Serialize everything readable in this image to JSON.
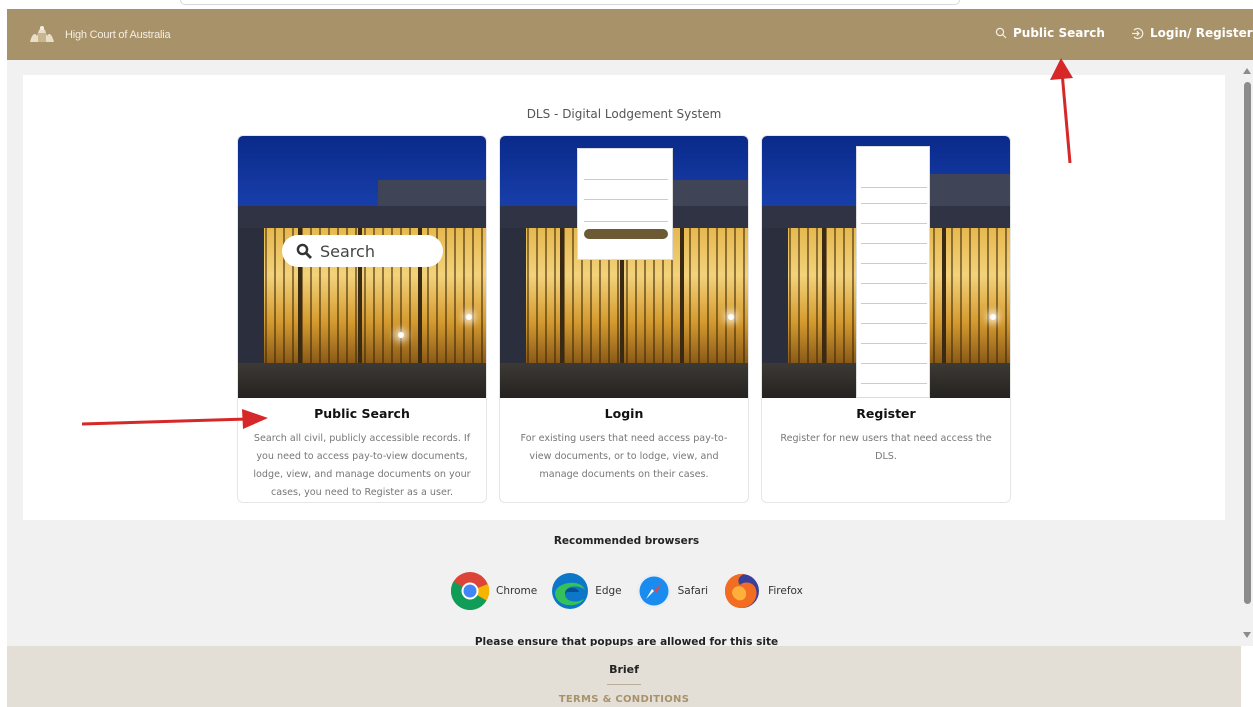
{
  "header": {
    "brand": "High Court of Australia",
    "nav": [
      {
        "label": "Public Search",
        "icon": "search-icon"
      },
      {
        "label": "Login/ Register",
        "icon": "login-icon"
      }
    ],
    "bg_color": "#a8926a"
  },
  "page_title": "DLS - Digital Lodgement System",
  "cards": [
    {
      "title": "Public Search",
      "description": "Search all civil, publicly accessible records. If you need to access pay-to-view documents, lodge, view, and manage documents on your cases, you need to Register as a user.",
      "overlay": {
        "search_label": "Search"
      }
    },
    {
      "title": "Login",
      "description": "For existing users that need access pay-to-view documents, or to lodge, view, and manage documents on their cases."
    },
    {
      "title": "Register",
      "description": "Register for new users that need access the DLS."
    }
  ],
  "browsers_section": {
    "title": "Recommended browsers",
    "browsers": [
      {
        "label": "Chrome",
        "icon": "chrome-icon"
      },
      {
        "label": "Edge",
        "icon": "edge-icon"
      },
      {
        "label": "Safari",
        "icon": "safari-icon"
      },
      {
        "label": "Firefox",
        "icon": "firefox-icon"
      }
    ],
    "popups_note": "Please ensure that popups are allowed for this site"
  },
  "footer": {
    "brief": "Brief",
    "terms": "TERMS & CONDITIONS",
    "bg_color": "#e4dfd6"
  },
  "annotation_color": "#d62828"
}
